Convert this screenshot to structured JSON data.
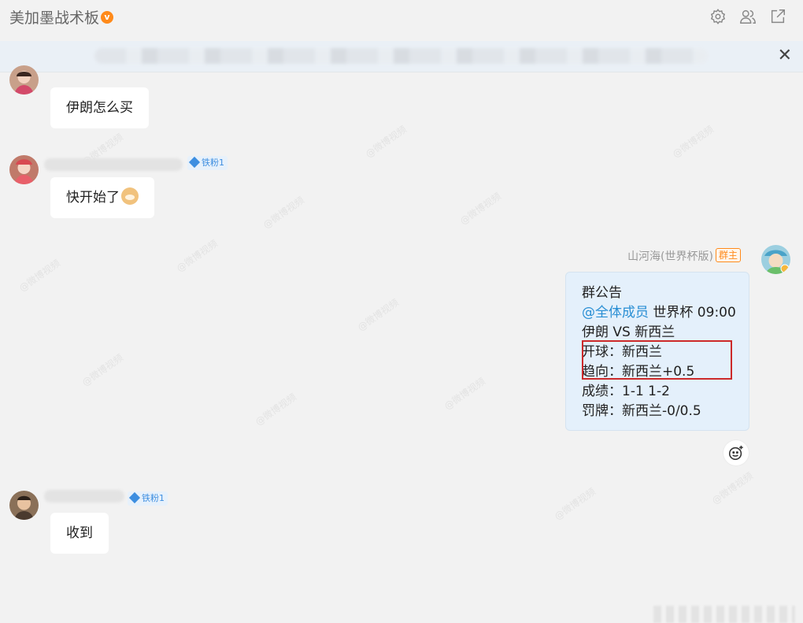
{
  "header": {
    "title": "美加墨战术板",
    "icons": [
      "gear-icon",
      "group-members-icon",
      "external-open-icon"
    ]
  },
  "notice": {
    "close_label": "✕"
  },
  "messages": [
    {
      "text": "伊朗怎么买"
    },
    {
      "badge": "铁粉1",
      "text": "快开始了"
    },
    {
      "badge": "铁粉1",
      "text": "收到"
    }
  ],
  "owner": {
    "name": "山河海(世界杯版)",
    "tag": "群主",
    "announcement": {
      "title": "群公告",
      "mention": "@全体成员",
      "event": " 世界杯 09:00",
      "match": "伊朗 VS 新西兰",
      "kickoff": "开球：新西兰",
      "trend": "趋向：新西兰+0.5",
      "score": "成绩：1-1 1-2",
      "cards": "罚牌：新西兰-0/0.5"
    }
  },
  "colors": {
    "accent": "#2a8fd4",
    "owner_tag": "#ff8a1a",
    "highlight": "#cc2a2a"
  }
}
